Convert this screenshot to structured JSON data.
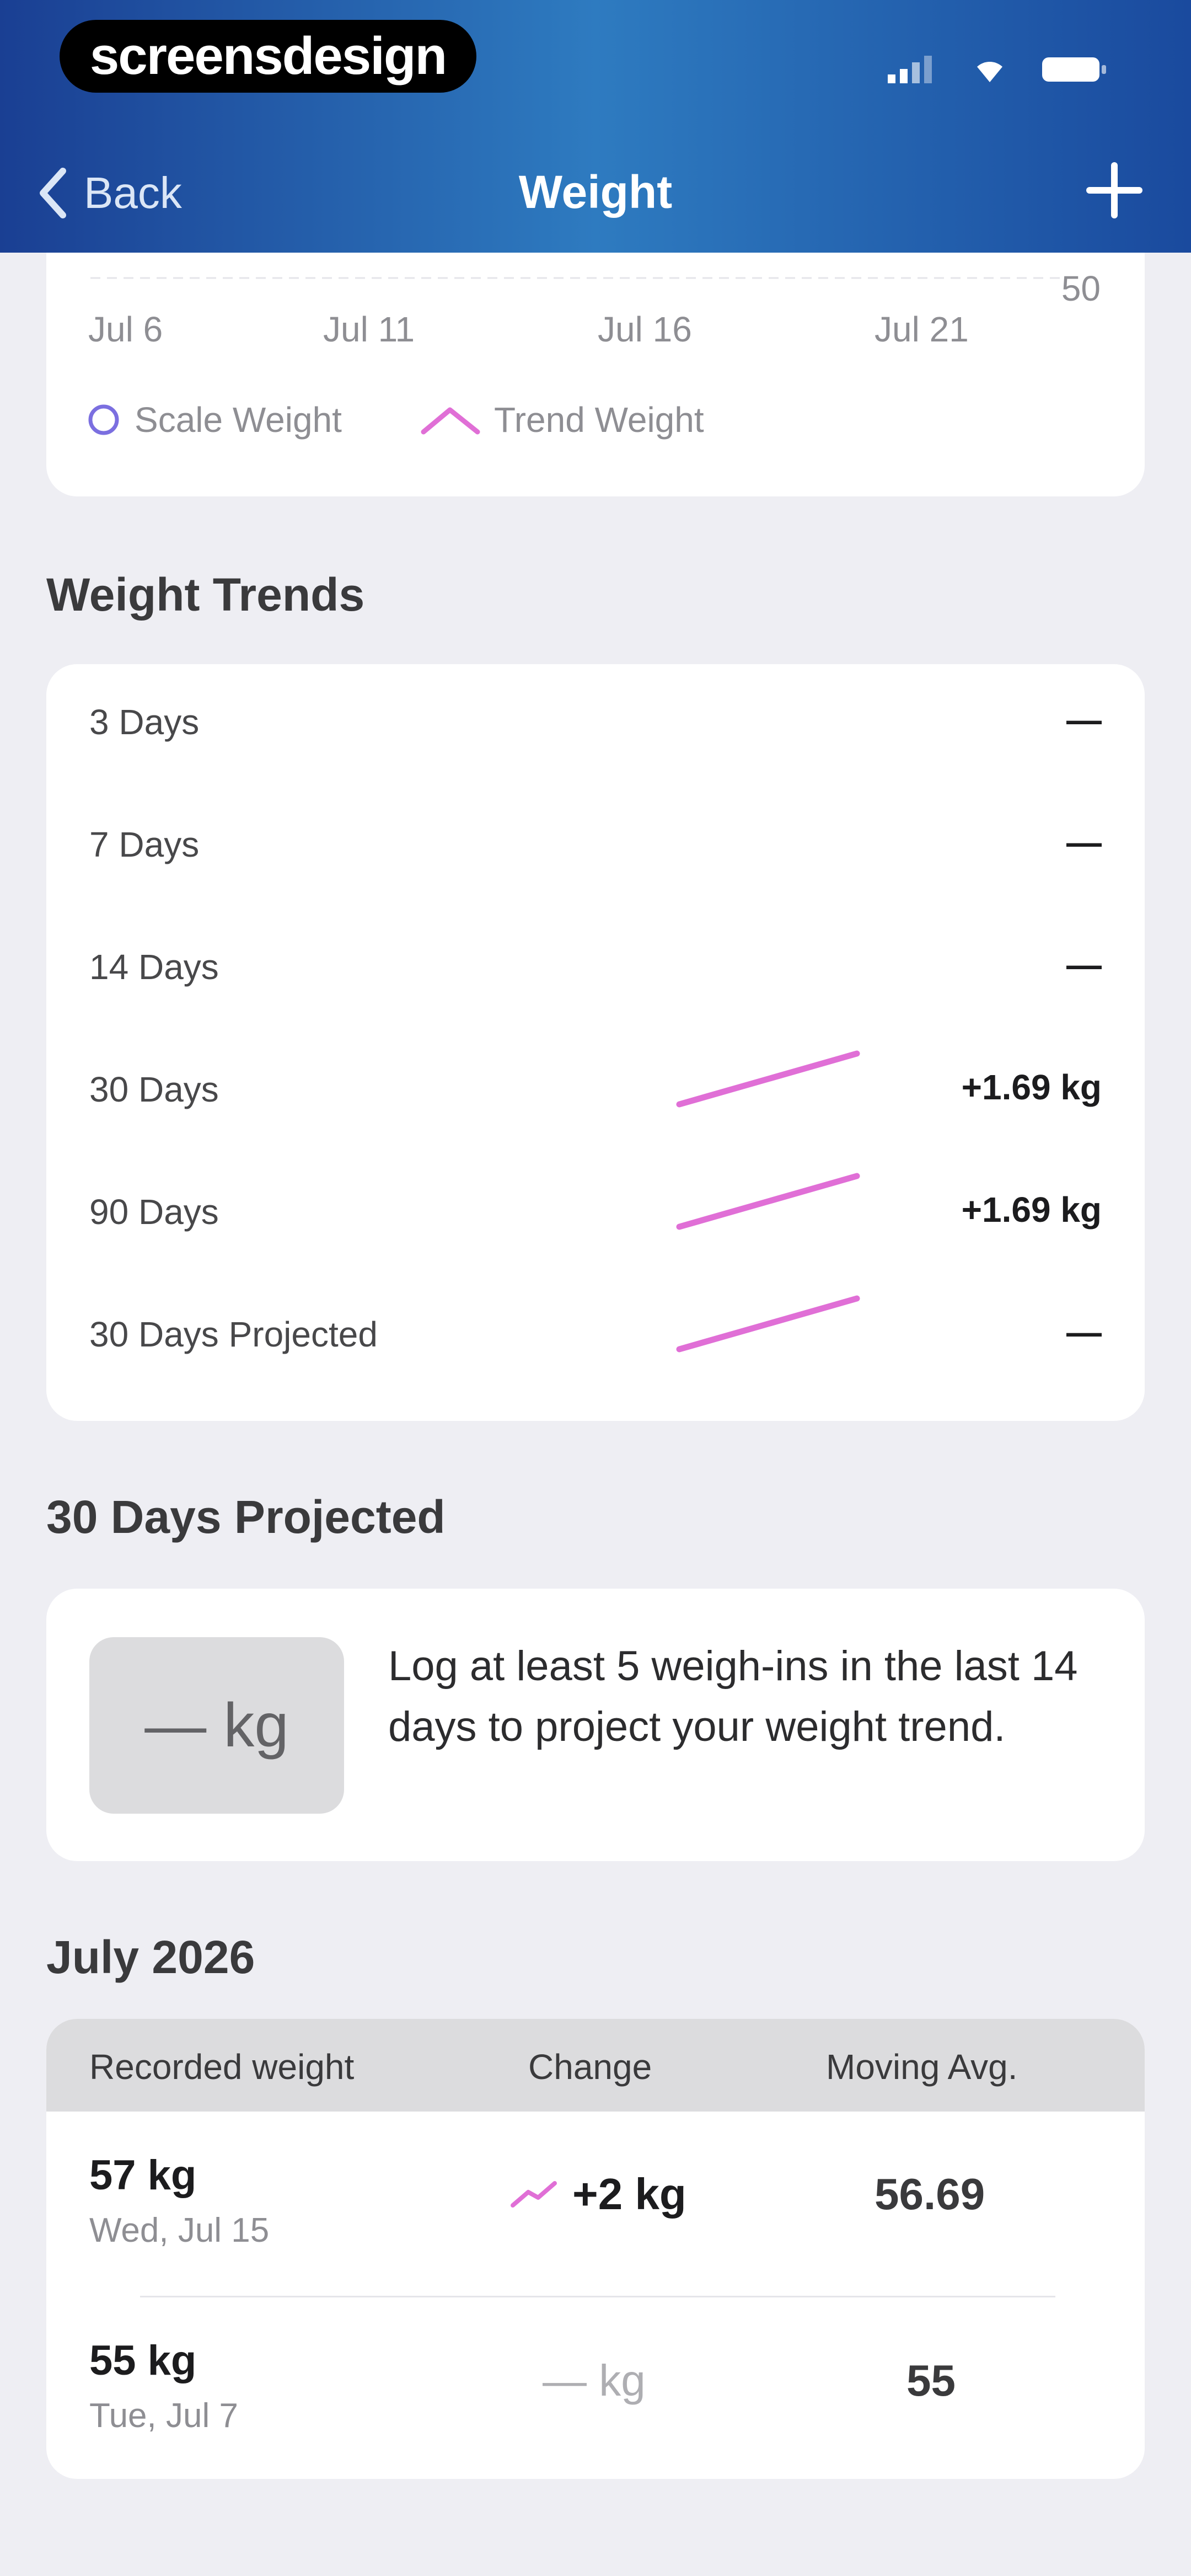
{
  "status_bar": {
    "brand": "screensdesign"
  },
  "nav": {
    "back_label": "Back",
    "title": "Weight"
  },
  "chart_data": {
    "type": "line",
    "x_tick_labels": [
      "Jul 6",
      "Jul 11",
      "Jul 16",
      "Jul 21"
    ],
    "y_tick_labels": [
      "50"
    ],
    "series": [
      {
        "name": "Scale Weight",
        "color": "#7b6fe0"
      },
      {
        "name": "Trend Weight",
        "color": "#e06fd6"
      }
    ]
  },
  "weight_trends": {
    "title": "Weight Trends",
    "rows": [
      {
        "label": "3 Days",
        "value": "—",
        "has_sparkline": false
      },
      {
        "label": "7 Days",
        "value": "—",
        "has_sparkline": false
      },
      {
        "label": "14 Days",
        "value": "—",
        "has_sparkline": false
      },
      {
        "label": "30 Days",
        "value": "+1.69 kg",
        "has_sparkline": true
      },
      {
        "label": "90 Days",
        "value": "+1.69 kg",
        "has_sparkline": true
      },
      {
        "label": "30 Days Projected",
        "value": "—",
        "has_sparkline": true
      }
    ]
  },
  "projected": {
    "title": "30 Days Projected",
    "value": "— kg",
    "message": "Log at least 5 weigh-ins in the last 14 days to project your weight trend."
  },
  "log": {
    "title": "July 2026",
    "headers": [
      "Recorded weight",
      "Change",
      "Moving Avg."
    ],
    "rows": [
      {
        "weight": "57 kg",
        "date": "Wed, Jul 15",
        "change": "+2 kg",
        "avg": "56.69",
        "trend_icon": "trend-up-icon"
      },
      {
        "weight": "55 kg",
        "date": "Tue, Jul 7",
        "change": "— kg",
        "avg": "55",
        "trend_icon": ""
      }
    ]
  },
  "colors": {
    "accent": "#e06fd6",
    "header_start": "#1a3f93",
    "header_mid": "#2e7bc0"
  }
}
